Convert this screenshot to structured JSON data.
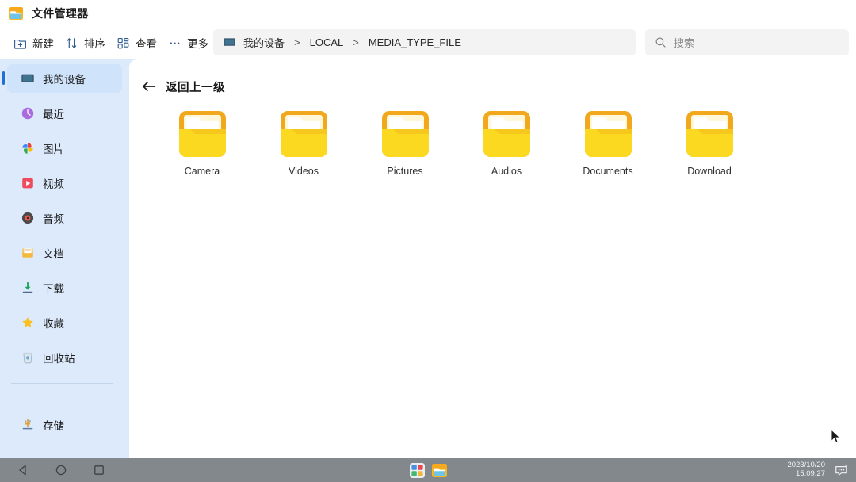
{
  "window": {
    "title": "文件管理器",
    "icon": "file-manager-icon"
  },
  "toolbar": {
    "buttons": [
      {
        "label": "新建",
        "icon": "new-folder-icon"
      },
      {
        "label": "排序",
        "icon": "sort-icon"
      },
      {
        "label": "查看",
        "icon": "view-grid-icon"
      },
      {
        "label": "更多",
        "icon": "more-ellipsis-icon"
      }
    ]
  },
  "address": {
    "icon": "device-monitor-icon",
    "crumbs": [
      "我的设备",
      "LOCAL",
      "MEDIA_TYPE_FILE"
    ],
    "separator": ">"
  },
  "search": {
    "icon": "search-icon",
    "placeholder": "搜索",
    "value": ""
  },
  "sidebar": {
    "items": [
      {
        "label": "我的设备",
        "icon": "device-monitor-icon",
        "active": true
      },
      {
        "label": "最近",
        "icon": "clock-icon",
        "active": false
      },
      {
        "label": "图片",
        "icon": "photos-pinwheel-icon",
        "active": false
      },
      {
        "label": "视频",
        "icon": "video-play-icon",
        "active": false
      },
      {
        "label": "音频",
        "icon": "audio-disc-icon",
        "active": false
      },
      {
        "label": "文档",
        "icon": "documents-icon",
        "active": false
      },
      {
        "label": "下载",
        "icon": "download-icon",
        "active": false
      },
      {
        "label": "收藏",
        "icon": "star-icon",
        "active": false
      },
      {
        "label": "回收站",
        "icon": "trash-icon",
        "active": false
      }
    ],
    "footer": [
      {
        "label": "存储",
        "icon": "storage-usb-icon"
      }
    ]
  },
  "main": {
    "back": {
      "label": "返回上一级",
      "icon": "arrow-left-icon"
    },
    "folders": [
      {
        "name": "Camera",
        "icon": "folder-icon"
      },
      {
        "name": "Videos",
        "icon": "folder-icon"
      },
      {
        "name": "Pictures",
        "icon": "folder-icon"
      },
      {
        "name": "Audios",
        "icon": "folder-icon"
      },
      {
        "name": "Documents",
        "icon": "folder-icon"
      },
      {
        "name": "Download",
        "icon": "folder-icon"
      }
    ]
  },
  "taskbar": {
    "nav": [
      {
        "name": "back",
        "icon": "nav-back-triangle-icon"
      },
      {
        "name": "home",
        "icon": "nav-home-circle-icon"
      },
      {
        "name": "recents",
        "icon": "nav-recents-square-icon"
      }
    ],
    "apps": [
      {
        "name": "app-grid",
        "icon": "app-grid-icon"
      },
      {
        "name": "file-manager",
        "icon": "file-manager-icon"
      }
    ],
    "clock": {
      "date": "2023/10/20",
      "time": "15:09:27"
    },
    "tray": [
      {
        "name": "notifications",
        "icon": "notification-bubble-icon"
      }
    ]
  },
  "colors": {
    "sidebar_bg": "#dceafc",
    "sidebar_active": "#cfe3fb",
    "accent": "#1f6fd6",
    "content_bg": "#ffffff",
    "taskbar_bg": "#83888d",
    "folder_front": "#fbd31f",
    "folder_back": "#f5a91b"
  }
}
